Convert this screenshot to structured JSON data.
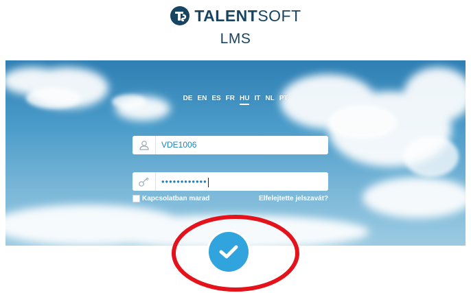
{
  "brand": {
    "logo_bold": "TALENT",
    "logo_light": "SOFT",
    "product": "LMS",
    "colors": {
      "brand_navy": "#174460",
      "accent_blue": "#31a4dd",
      "annotation_red": "#e3121b"
    }
  },
  "languages": {
    "items": [
      "DE",
      "EN",
      "ES",
      "FR",
      "HU",
      "IT",
      "NL",
      "PT"
    ],
    "active": "HU"
  },
  "login": {
    "username_value": "VDE1006",
    "password_value": "••••••••••••",
    "remember_label": "Kapcsolatban marad",
    "forgot_label": "Elfelejtette jelszavát?",
    "user_icon": "user-icon",
    "password_icon": "key-icon",
    "submit_icon": "checkmark-icon"
  }
}
